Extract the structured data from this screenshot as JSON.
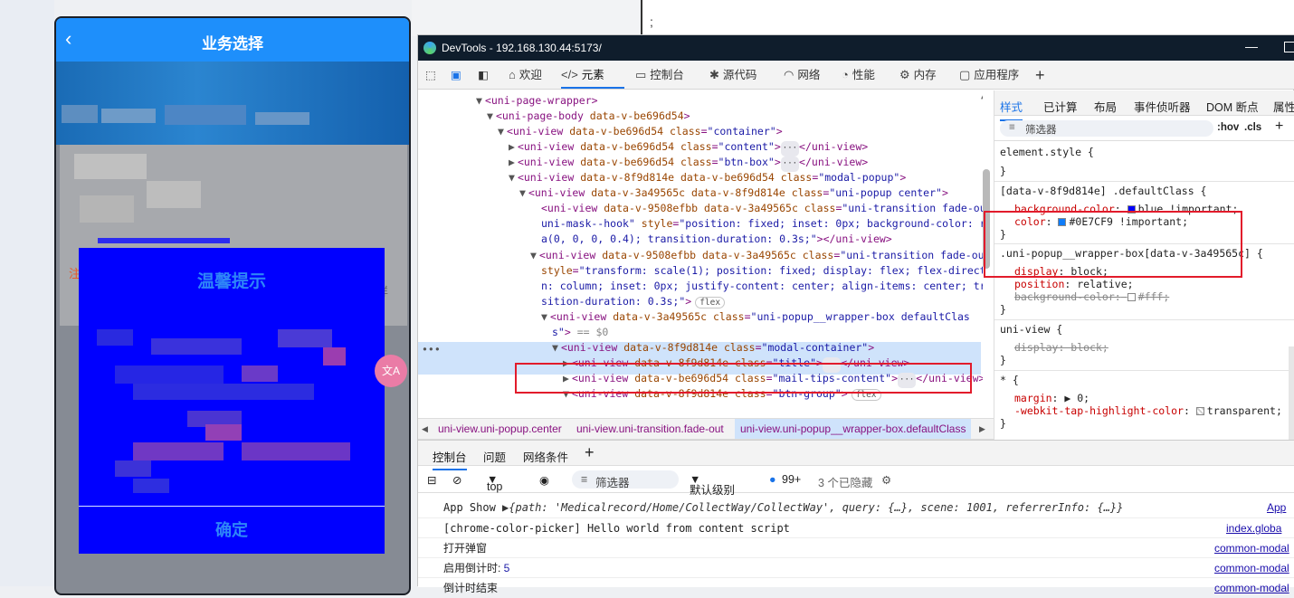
{
  "background_window": {
    "char": ";"
  },
  "phone": {
    "nav_title": "业务选择",
    "back_icon": "‹",
    "hint_left": "注",
    "hint_right": "详",
    "modal": {
      "title": "温馨提示",
      "confirm": "确定"
    },
    "translate_label": "文A"
  },
  "devtools": {
    "window_title": "DevTools - 192.168.130.44:5173/",
    "tabs": [
      "欢迎",
      "元素",
      "控制台",
      "源代码",
      "网络",
      "性能",
      "内存",
      "应用程序"
    ],
    "tree_lines": [
      {
        "indent": 0,
        "arrow": "▼",
        "parts": [
          [
            "tag",
            "<uni-page-wrapper>"
          ]
        ]
      },
      {
        "indent": 1,
        "arrow": "▼",
        "parts": [
          [
            "tag",
            "<uni-page-body "
          ],
          [
            "an",
            "data-v-be696d54"
          ],
          [
            "tag",
            ">"
          ]
        ]
      },
      {
        "indent": 2,
        "arrow": "▼",
        "parts": [
          [
            "tag",
            "<uni-view "
          ],
          [
            "an",
            "data-v-be696d54 class"
          ],
          [
            "tag",
            "="
          ],
          [
            "av",
            "\"container\""
          ],
          [
            "tag",
            ">"
          ]
        ]
      },
      {
        "indent": 3,
        "arrow": "▶",
        "parts": [
          [
            "tag",
            "<uni-view "
          ],
          [
            "an",
            "data-v-be696d54 class"
          ],
          [
            "tag",
            "="
          ],
          [
            "av",
            "\"content\""
          ],
          [
            "tag",
            ">"
          ],
          [
            "dots",
            "···"
          ],
          [
            "tag",
            "</uni-view>"
          ]
        ]
      },
      {
        "indent": 3,
        "arrow": "▶",
        "parts": [
          [
            "tag",
            "<uni-view "
          ],
          [
            "an",
            "data-v-be696d54 class"
          ],
          [
            "tag",
            "="
          ],
          [
            "av",
            "\"btn-box\""
          ],
          [
            "tag",
            ">"
          ],
          [
            "dots",
            "···"
          ],
          [
            "tag",
            "</uni-view>"
          ]
        ]
      },
      {
        "indent": 3,
        "arrow": "▼",
        "parts": [
          [
            "tag",
            "<uni-view "
          ],
          [
            "an",
            "data-v-8f9d814e data-v-be696d54 class"
          ],
          [
            "tag",
            "="
          ],
          [
            "av",
            "\"modal-popup\""
          ],
          [
            "tag",
            ">"
          ]
        ]
      },
      {
        "indent": 4,
        "arrow": "▼",
        "parts": [
          [
            "tag",
            "<uni-view "
          ],
          [
            "an",
            "data-v-3a49565c data-v-8f9d814e class"
          ],
          [
            "tag",
            "="
          ],
          [
            "av",
            "\"uni-popup center\""
          ],
          [
            "tag",
            ">"
          ]
        ]
      },
      {
        "indent": 5,
        "arrow": "",
        "parts": [
          [
            "tag",
            "<uni-view "
          ],
          [
            "an",
            "data-v-9508efbb data-v-3a49565c class"
          ],
          [
            "tag",
            "="
          ],
          [
            "av",
            "\"uni-transition fade-out"
          ]
        ]
      },
      {
        "indent": 5,
        "arrow": "",
        "parts": [
          [
            "av",
            "uni-mask--hook\" "
          ],
          [
            "an",
            "style"
          ],
          [
            "tag",
            "="
          ],
          [
            "av",
            "\"position: fixed; inset: 0px; background-color: rgb"
          ]
        ]
      },
      {
        "indent": 5,
        "arrow": "",
        "parts": [
          [
            "av",
            "a(0, 0, 0, 0.4); transition-duration: 0.3s;\""
          ],
          [
            "tag",
            "></uni-view>"
          ]
        ]
      },
      {
        "indent": 5,
        "arrow": "▼",
        "parts": [
          [
            "tag",
            "<uni-view "
          ],
          [
            "an",
            "data-v-9508efbb data-v-3a49565c class"
          ],
          [
            "tag",
            "="
          ],
          [
            "av",
            "\"uni-transition fade-out\""
          ]
        ]
      },
      {
        "indent": 5,
        "arrow": "",
        "parts": [
          [
            "an",
            "style"
          ],
          [
            "tag",
            "="
          ],
          [
            "av",
            "\"transform: scale(1); position: fixed; display: flex; flex-directio"
          ]
        ]
      },
      {
        "indent": 5,
        "arrow": "",
        "parts": [
          [
            "av",
            "n: column; inset: 0px; justify-content: center; align-items: center; tran"
          ]
        ]
      },
      {
        "indent": 5,
        "arrow": "",
        "parts": [
          [
            "av",
            "sition-duration: 0.3s;\""
          ],
          [
            "tag",
            ">"
          ],
          [
            "badge",
            "flex"
          ]
        ]
      },
      {
        "indent": 6,
        "arrow": "▼",
        "parts": [
          [
            "tag",
            "<uni-view "
          ],
          [
            "an",
            "data-v-3a49565c class"
          ],
          [
            "tag",
            "="
          ],
          [
            "av",
            "\"uni-popup__wrapper-box defaultClas"
          ]
        ]
      },
      {
        "indent": 6,
        "arrow": "",
        "parts": [
          [
            "av",
            "s\""
          ],
          [
            "tag",
            ">"
          ],
          [
            "gray",
            " == $0"
          ]
        ]
      },
      {
        "indent": 7,
        "arrow": "▼",
        "parts": [
          [
            "tag",
            "<uni-view "
          ],
          [
            "an",
            "data-v-8f9d814e class"
          ],
          [
            "tag",
            "="
          ],
          [
            "av",
            "\"modal-container\""
          ],
          [
            "tag",
            ">"
          ]
        ]
      },
      {
        "indent": 8,
        "arrow": "▶",
        "parts": [
          [
            "tag",
            "<uni-view "
          ],
          [
            "an",
            "data-v-8f9d814e class"
          ],
          [
            "tag",
            "="
          ],
          [
            "av",
            "\"title\""
          ],
          [
            "tag",
            ">"
          ],
          [
            "dots",
            "···"
          ],
          [
            "tag",
            "</uni-view>"
          ]
        ]
      },
      {
        "indent": 8,
        "arrow": "▶",
        "parts": [
          [
            "tag",
            "<uni-view "
          ],
          [
            "an",
            "data-v-be696d54 class"
          ],
          [
            "tag",
            "="
          ],
          [
            "av",
            "\"mail-tips-content\""
          ],
          [
            "tag",
            ">"
          ],
          [
            "dots",
            "···"
          ],
          [
            "tag",
            "</uni-view>"
          ]
        ]
      },
      {
        "indent": 8,
        "arrow": "▼",
        "parts": [
          [
            "tag",
            "<uni-view "
          ],
          [
            "an",
            "data-v-8f9d814e class"
          ],
          [
            "tag",
            "="
          ],
          [
            "av",
            "\"btn-group\""
          ],
          [
            "tag",
            ">"
          ],
          [
            "badge",
            "flex"
          ]
        ]
      }
    ],
    "breadcrumbs": [
      "uni-view.uni-popup.center",
      "uni-view.uni-transition.fade-out",
      "uni-view.uni-popup__wrapper-box.defaultClass"
    ],
    "styles_tabs": [
      "样式",
      "已计算",
      "布局",
      "事件侦听器",
      "DOM 断点",
      "属性"
    ],
    "filter_placeholder": "筛选器",
    "hov": ":hov",
    "cls": ".cls",
    "rules": {
      "element_style": "element.style {",
      "close": "}",
      "default_sel": "[data-v-8f9d814e] .defaultClass {",
      "default_p1": "background-color",
      "default_v1": "blue !important;",
      "default_p2": "color",
      "default_v2": "#0E7CF9 !important;",
      "wrapper_sel": ".uni-popup__wrapper-box[data-v-3a49565c] {",
      "wrapper_p1": "display",
      "wrapper_v1": "block;",
      "wrapper_p2": "position",
      "wrapper_v2": "relative;",
      "wrapper_p3": "background-color:",
      "wrapper_v3": "#fff;",
      "uniview_sel": "uni-view {",
      "uniview_p1": "display: block;",
      "star_sel": "* {",
      "star_p1": "margin",
      "star_v1": "▶ 0;",
      "star_p2": "-webkit-tap-highlight-color",
      "star_v2": "transparent;"
    },
    "colors": {
      "blue": "#0000ff",
      "accent": "#0E7CF9",
      "white": "#ffffff"
    },
    "console": {
      "tabs": [
        "控制台",
        "问题",
        "网络条件"
      ],
      "context": "top",
      "filter": "筛选器",
      "level": "默认级别",
      "count": "99+",
      "hidden": "3 个已隐藏",
      "lines": [
        {
          "text_a": "App Show ",
          "text_b": "▶{path: 'Medicalrecord/Home/CollectWay/CollectWay', query: {…}, scene: 1001, referrerInfo: {…}}",
          "src": "App"
        },
        {
          "text_a": "[chrome-color-picker] Hello world from content script",
          "text_b": "",
          "src": "index.globa"
        },
        {
          "text_a": "打开弹窗",
          "text_b": "",
          "src": "common-modal"
        },
        {
          "text_a": "启用倒计时: ",
          "text_b": "5",
          "src": "common-modal"
        },
        {
          "text_a": "倒计时结束",
          "text_b": "",
          "src": "common-modal"
        }
      ]
    }
  }
}
